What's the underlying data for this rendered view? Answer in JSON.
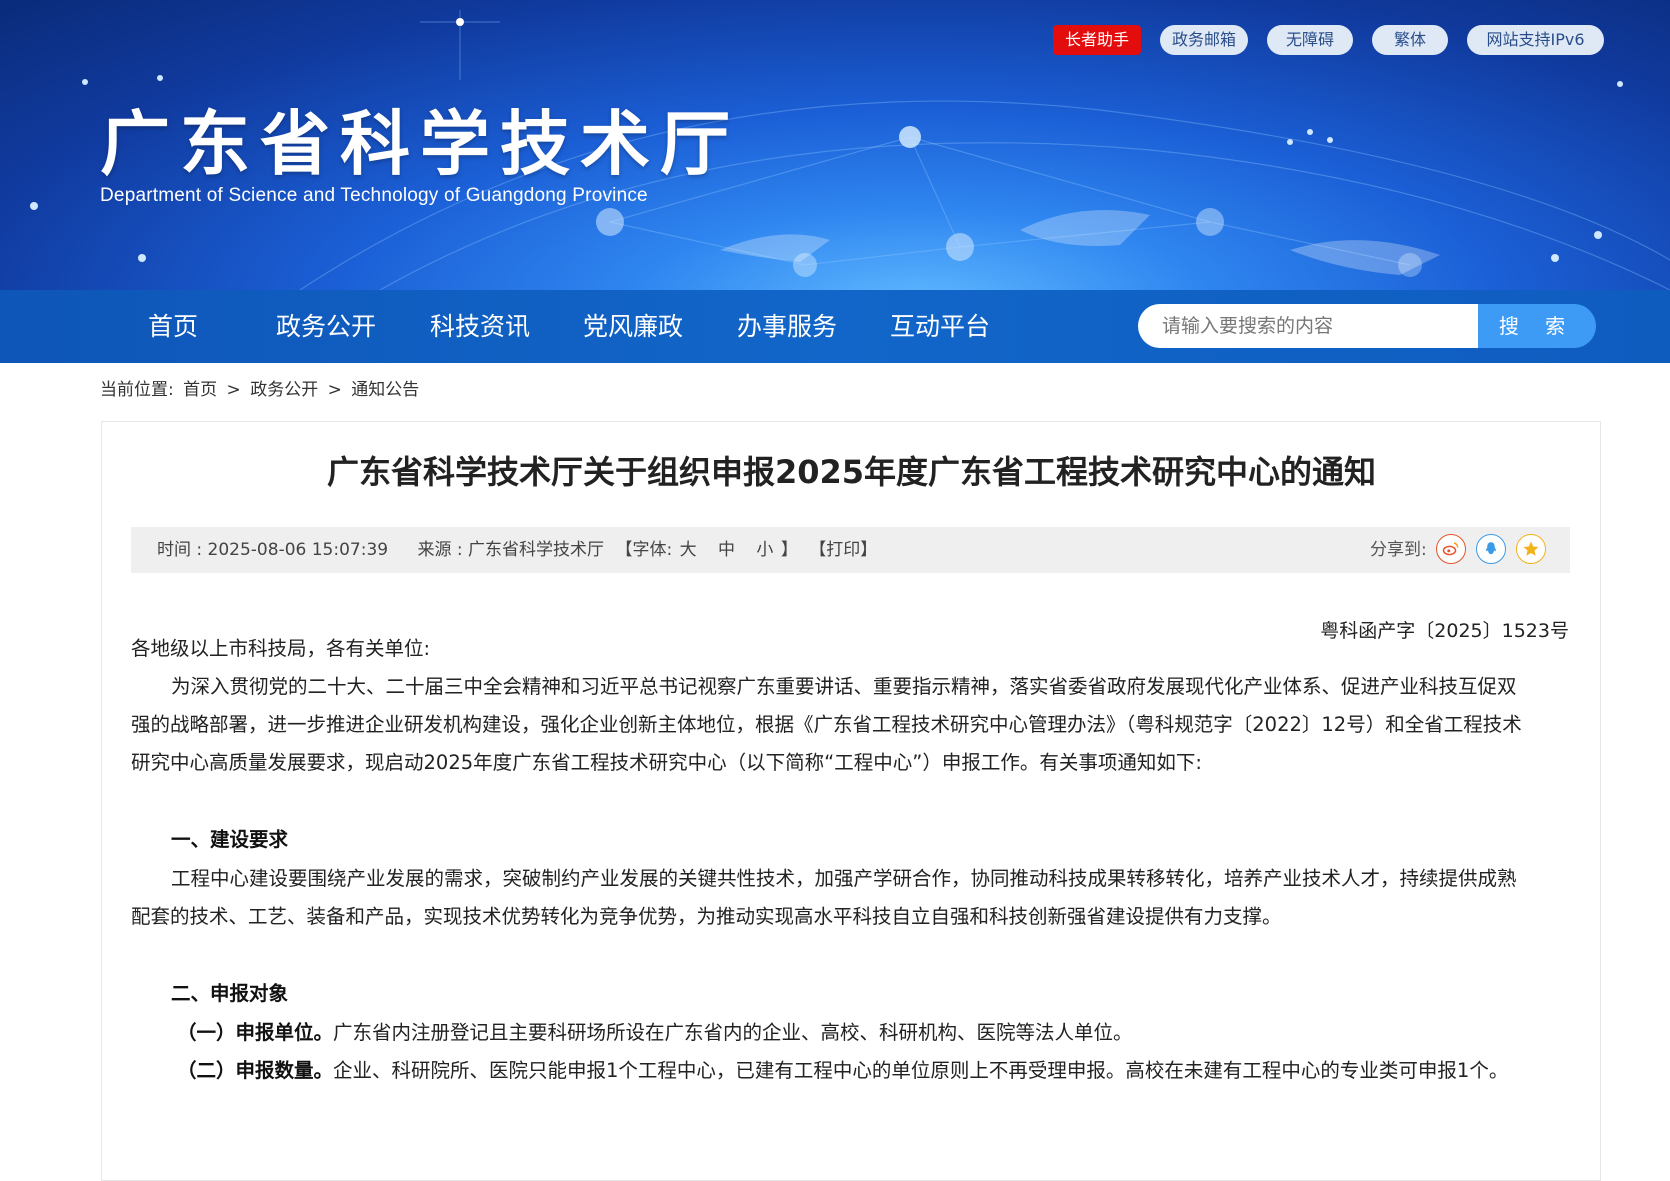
{
  "header": {
    "title": "广东省科学技术厅",
    "subtitle": "Department of Science and Technology of Guangdong Province",
    "top_links": [
      "长者助手",
      "政务邮箱",
      "无障碍",
      "繁体",
      "网站支持IPv6"
    ]
  },
  "nav": {
    "items": [
      "首页",
      "政务公开",
      "科技资讯",
      "党风廉政",
      "办事服务",
      "互动平台"
    ],
    "search_placeholder": "请输入要搜索的内容",
    "search_button": "搜 索"
  },
  "breadcrumb": {
    "prefix": "当前位置:",
    "items": [
      "首页",
      ">",
      "政务公开",
      ">",
      "通知公告"
    ]
  },
  "article": {
    "title": "广东省科学技术厅关于组织申报2025年度广东省工程技术研究中心的通知",
    "meta": {
      "time": "时间 : 2025-08-06 15:07:39",
      "source": "来源 : 广东省科学技术厅",
      "font_prefix": "【字体:",
      "font_large": "大",
      "font_medium": "中",
      "font_small": "小",
      "font_suffix": "】",
      "print": "【打印】",
      "share_label": "分享到:"
    },
    "doc_number": "粤科函产字〔2025〕1523号",
    "salutation": "各地级以上市科技局，各有关单位:",
    "intro_lines": [
      "为深入贯彻党的二十大、二十届三中全会精神和习近平总书记视察广东重要讲话、重要指示精神，落实省委省政府发展现代化产业体系、促进产业科技互促双",
      "强的战略部署，进一步推进企业研发机构建设，强化企业创新主体地位，根据《广东省工程技术研究中心管理办法》（粤科规范字〔2022〕12号）和全省工程技术",
      "研究中心高质量发展要求，现启动2025年度广东省工程技术研究中心（以下简称“工程中心”）申报工作。有关事项通知如下:"
    ],
    "section1": {
      "heading": "一、建设要求",
      "lines": [
        "工程中心建设要围绕产业发展的需求，突破制约产业发展的关键共性技术，加强产学研合作，协同推动科技成果转移转化，培养产业技术人才，持续提供成熟",
        "配套的技术、工艺、装备和产品，实现技术优势转化为竞争优势，为推动实现高水平科技自立自强和科技创新强省建设提供有力支撑。"
      ]
    },
    "section2": {
      "heading": "二、申报对象",
      "items": [
        {
          "label": "（一）申报单位。",
          "text": "广东省内注册登记且主要科研场所设在广东省内的企业、高校、科研机构、医院等法人单位。"
        },
        {
          "label": "（二）申报数量。",
          "text": "企业、科研院所、医院只能申报1个工程中心，已建有工程中心的单位原则上不再受理申报。高校在未建有工程中心的专业类可申报1个。"
        }
      ]
    }
  },
  "colors": {
    "nav_blue": "#1266c9",
    "search_button": "#3d9bf5",
    "elder_red": "#e40d0d",
    "weibo": "#e6532c",
    "qq": "#3a9be8",
    "favorite": "#f2b21a"
  },
  "icons": {
    "share": [
      "weibo-icon",
      "qq-icon",
      "favorite-star-icon"
    ]
  }
}
